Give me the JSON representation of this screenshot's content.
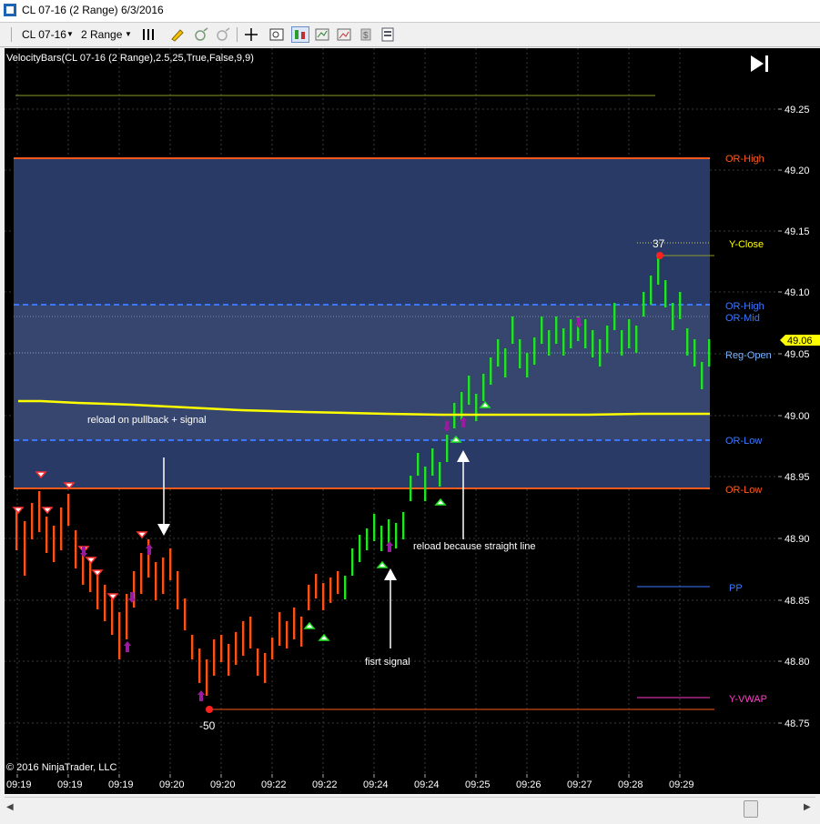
{
  "window": {
    "title": "CL 07-16 (2 Range)  6/3/2016"
  },
  "toolbar": {
    "instrument": "CL 07-16",
    "interval": "2 Range"
  },
  "indicator_label": "VelocityBars(CL 07-16 (2 Range),2.5,25,True,False,9,9)",
  "copyright": "© 2016 NinjaTrader, LLC",
  "price_axis": {
    "ticks": [
      "49.25",
      "49.20",
      "49.15",
      "49.10",
      "49.05",
      "49.00",
      "48.95",
      "48.90",
      "48.85",
      "48.80",
      "48.75"
    ],
    "current_price": "49.06",
    "current_price_color": "#ffff00"
  },
  "time_axis": {
    "ticks": [
      "09:19",
      "09:19",
      "09:19",
      "09:20",
      "09:20",
      "09:22",
      "09:22",
      "09:24",
      "09:24",
      "09:25",
      "09:26",
      "09:27",
      "09:28",
      "09:29"
    ]
  },
  "levels": [
    {
      "label": "OR-High",
      "color": "#ff5a1e"
    },
    {
      "label": "Y-Close",
      "color": "#ffff00"
    },
    {
      "label": "OR-High",
      "color": "#3c78ff"
    },
    {
      "label": "OR-Mid",
      "color": "#3c78ff"
    },
    {
      "label": "Reg-Open",
      "color": "#78b4ff"
    },
    {
      "label": "OR-Low",
      "color": "#3c78ff"
    },
    {
      "label": "OR-Low",
      "color": "#ff5a1e"
    },
    {
      "label": "PP",
      "color": "#3c78ff"
    },
    {
      "label": "Y-VWAP",
      "color": "#ff3cc8"
    }
  ],
  "annotations": {
    "reload_pullback": "reload on pullback + signal",
    "reload_straight": "reload because straight line",
    "first_signal": "fisrt signal",
    "high_count": "37",
    "low_count": "-50"
  },
  "colors": {
    "bull_bar": "#1ee61e",
    "bear_bar": "#ff5014",
    "vwap_line": "#ffff00",
    "range_fill": "#2a3a66"
  }
}
